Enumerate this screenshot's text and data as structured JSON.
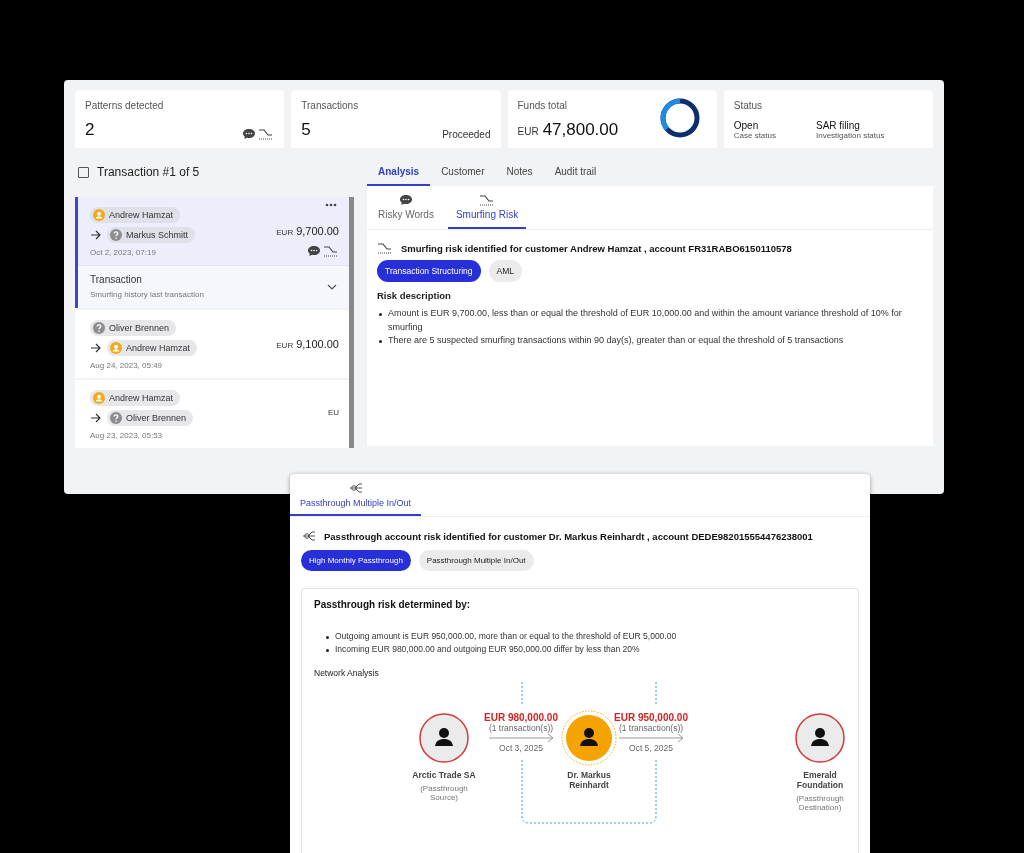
{
  "summary_cards": [
    {
      "kind": "patterns",
      "label": "Patterns detected",
      "value": "2"
    },
    {
      "kind": "transactions",
      "label": "Transactions",
      "value": "5",
      "note": "Proceeded"
    },
    {
      "kind": "funds",
      "label": "Funds total",
      "currency": "EUR",
      "value": "47,800.00"
    },
    {
      "kind": "status",
      "label": "Status",
      "items": [
        {
          "value": "Open",
          "caption": "Case status"
        },
        {
          "value": "SAR filing",
          "caption": "Investigation status"
        }
      ]
    }
  ],
  "transaction_list": {
    "header": "Transaction #1 of 5",
    "checked": false,
    "items": [
      {
        "selected": true,
        "from": {
          "name": "Andrew Hamzat",
          "kind": "person"
        },
        "to": {
          "name": "Markus Schmitt",
          "kind": "unknown"
        },
        "currency": "EUR",
        "amount": "9,700.00",
        "date": "Oct 2, 2023, 07:19",
        "risky_words": true,
        "smurfing": true,
        "detail": {
          "title": "Transaction",
          "subtitle": "Smurfing history last transaction"
        }
      },
      {
        "selected": false,
        "from": {
          "name": "Oliver Brennen",
          "kind": "unknown"
        },
        "to": {
          "name": "Andrew Hamzat",
          "kind": "person"
        },
        "currency": "EUR",
        "amount": "9,100.00",
        "date": "Aug 24, 2023, 05:49",
        "risky_words": false,
        "smurfing": false
      },
      {
        "selected": false,
        "from": {
          "name": "Andrew Hamzat",
          "kind": "person"
        },
        "to": {
          "name": "Oliver Brennen",
          "kind": "unknown"
        },
        "currency": "EU",
        "date": "Aug 23, 2023, 05:53",
        "risky_words": false,
        "smurfing": false
      }
    ]
  },
  "tabs": [
    {
      "label": "Analysis",
      "selected": true
    },
    {
      "label": "Customer",
      "selected": false
    },
    {
      "label": "Notes",
      "selected": false
    },
    {
      "label": "Audit trail",
      "selected": false
    }
  ],
  "risk_tabs": [
    {
      "label": "Risky Words",
      "kind": "words",
      "selected": false
    },
    {
      "label": "Smurfing Risk",
      "kind": "smurfing",
      "selected": true
    }
  ],
  "risk_panel": {
    "headline": "Smurfing risk identified for customer  Andrew Hamzat , account  FR31RABO6150110578",
    "tags": [
      {
        "label": "Transaction Structuring",
        "selected": true
      },
      {
        "label": "AML",
        "selected": false
      }
    ],
    "section": "Risk description",
    "bullets": [
      "Amount is EUR 9,700.00, less than or equal the threshold of EUR 10,000.00 and within the amount variance threshold of 10% for smurfing",
      "There are 5 suspected smurfing transactions within 90 day(s), greater than or equal the threshold of 5 transactions"
    ]
  },
  "popup": {
    "tabs": [
      {
        "label": "Passthrough Multiple In/Out",
        "selected": true
      }
    ],
    "headline": "Passthrough account risk identified for customer Dr. Markus Reinhardt , account DEDE982015554476238001",
    "tags": [
      {
        "label": "High Monthly Passthrough",
        "selected": true
      },
      {
        "label": "Passthrough Multiple In/Out",
        "selected": false
      }
    ],
    "card": {
      "title": "Passthrough risk determined by:",
      "bullets": [
        "Outgoing amount is EUR 950,000.00, more than or equal to the threshold of EUR 5,000.00",
        "Incoming EUR 980,000.00 and outgoing EUR 950,000.00 differ by less than 20%"
      ],
      "section": "Network Analysis",
      "network": {
        "nodes": [
          {
            "name": "Arctic Trade SA",
            "role": "(Passthrough Source)",
            "kind": "external"
          },
          {
            "name": "Dr. Markus Reinhardt",
            "kind": "subject"
          },
          {
            "name": "Emerald Foundation",
            "role": "(Passthrough Destination)",
            "kind": "external"
          }
        ],
        "flows": [
          {
            "amount": "EUR 980,000.00",
            "count": "(1 transaction(s))",
            "date": "Oct 3, 2025"
          },
          {
            "amount": "EUR 950,000.00",
            "count": "(1 transaction(s))",
            "date": "Oct 5, 2025"
          }
        ]
      }
    }
  }
}
